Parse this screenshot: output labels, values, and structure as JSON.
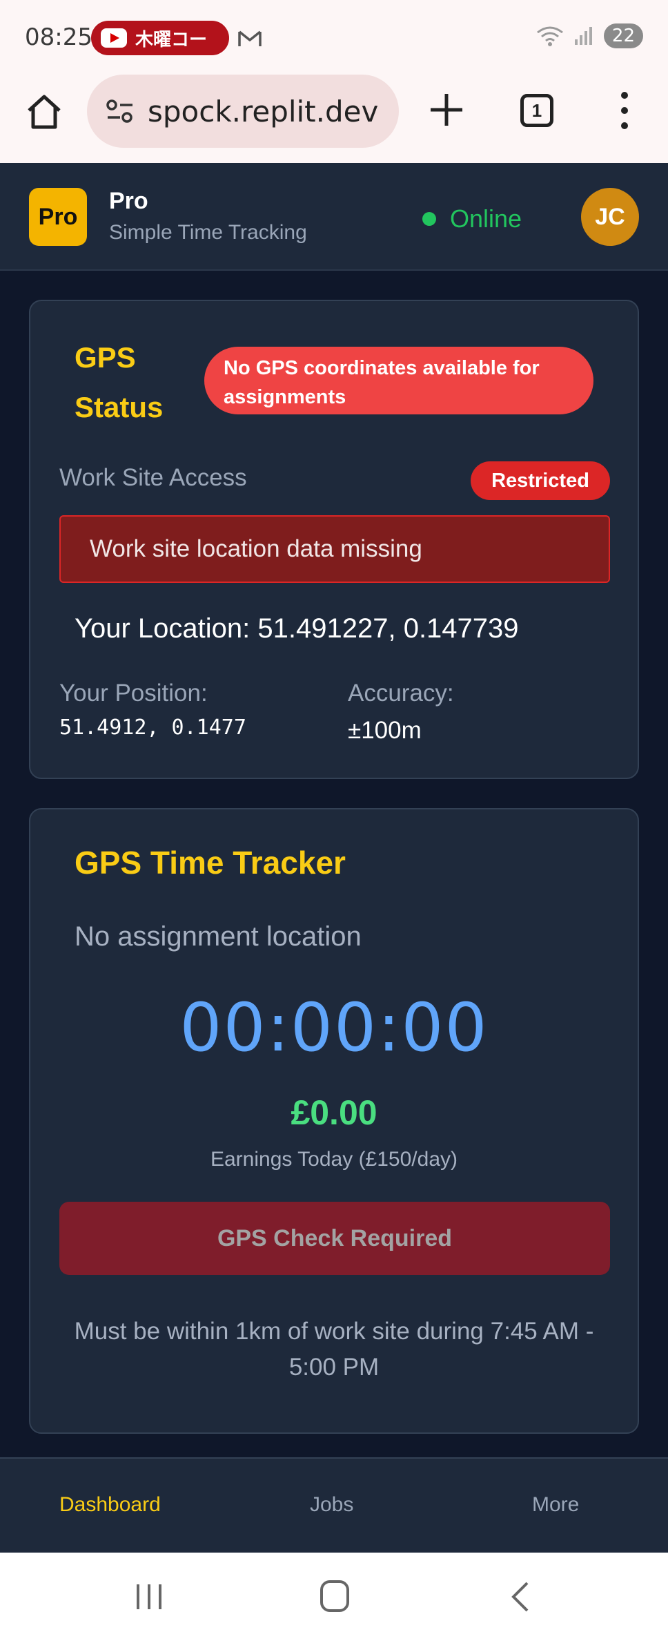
{
  "status_bar": {
    "time": "08:25",
    "notification_text": "木曜コー",
    "battery": "22"
  },
  "browser": {
    "url": "spock.replit.dev",
    "tab_count": "1"
  },
  "app": {
    "logo_text": "Pro",
    "title": "Pro",
    "subtitle": "Simple Time Tracking",
    "status": "Online",
    "user_initials": "JC"
  },
  "gps_status": {
    "title": "GPS Status",
    "badge": "No GPS coordinates available for assignments",
    "access_label": "Work Site Access",
    "access_badge": "Restricted",
    "alert": "Work site location data missing",
    "your_location": "Your Location: 51.491227, 0.147739",
    "position_label": "Your Position:",
    "position_value": "51.4912, 0.1477",
    "accuracy_label": "Accuracy:",
    "accuracy_value": "±100m"
  },
  "tracker": {
    "title": "GPS Time Tracker",
    "assignment": "No assignment location",
    "timer": "00:00:00",
    "earnings": "£0.00",
    "earnings_label": "Earnings Today (£150/day)",
    "button_label": "GPS Check Required",
    "note": "Must be within 1km of work site during 7:45 AM - 5:00 PM"
  },
  "bottom_nav": {
    "items": [
      {
        "label": "Dashboard",
        "active": true
      },
      {
        "label": "Jobs",
        "active": false
      },
      {
        "label": "More",
        "active": false
      }
    ]
  },
  "colors": {
    "accent": "#facc15",
    "online": "#22c55e",
    "danger": "#ef4444",
    "timer": "#60a5fa",
    "earnings": "#4ade80"
  }
}
